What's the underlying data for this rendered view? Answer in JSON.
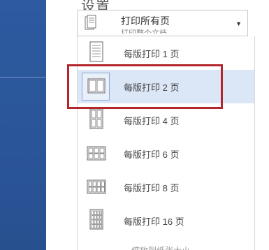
{
  "settings": {
    "title": "设置",
    "dropdown": {
      "selected_label": "打印所有页",
      "selected_sub": "打印整个文档",
      "arrow": "▼"
    },
    "options": [
      {
        "label": "每版打印 1 页",
        "icon": "one-page-icon"
      },
      {
        "label": "每版打印 2 页",
        "icon": "two-pages-icon",
        "selected": true
      },
      {
        "label": "每版打印 4 页",
        "icon": "four-pages-icon"
      },
      {
        "label": "每版打印 6 页",
        "icon": "six-pages-icon"
      },
      {
        "label": "每版打印 8 页",
        "icon": "eight-pages-icon"
      },
      {
        "label": "每版打印 16 页",
        "icon": "sixteen-pages-icon"
      }
    ],
    "next_cut_label": "缩放到纸张大小"
  },
  "colors": {
    "sidebar_blue": "#2a5598",
    "selected_bg": "#dbe6f6",
    "highlight_red": "#b3262b"
  }
}
